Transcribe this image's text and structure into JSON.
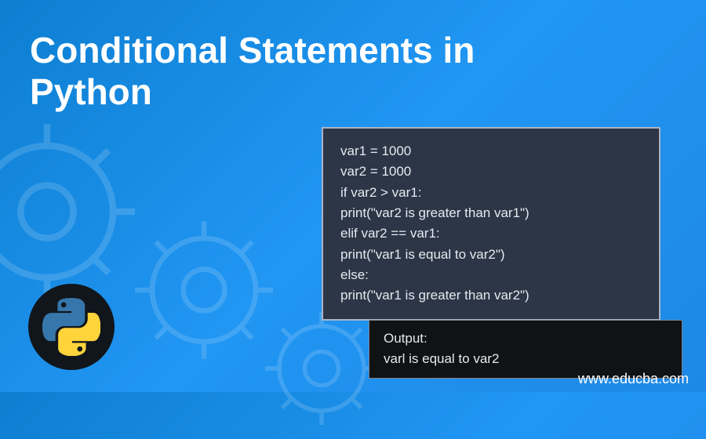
{
  "title": "Conditional Statements in Python",
  "code": {
    "line1": "var1 = 1000",
    "line2": "var2 = 1000",
    "line3": "if var2 > var1:",
    "line4": "print(\"var2 is greater than var1\")",
    "line5": "elif var2 == var1:",
    "line6": "print(\"var1 is equal to var2\")",
    "line7": "else:",
    "line8": "print(\"var1 is greater than var2\")"
  },
  "output": {
    "label": "Output:",
    "line1": "varl is equal to var2"
  },
  "footer": {
    "url": "www.educba.com"
  },
  "logo": {
    "name": "python-logo"
  }
}
